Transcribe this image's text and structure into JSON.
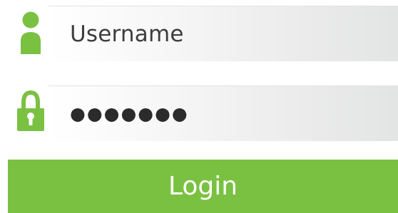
{
  "login_form": {
    "username": {
      "placeholder": "Username",
      "icon": "user-icon"
    },
    "password": {
      "masked_value": "●●●●●●●",
      "icon": "lock-icon"
    },
    "submit_label": "Login"
  },
  "colors": {
    "accent": "#7ac142",
    "field_background_start": "#ffffff",
    "field_background_end": "#e3e4e4",
    "text": "#3d3d3d"
  }
}
